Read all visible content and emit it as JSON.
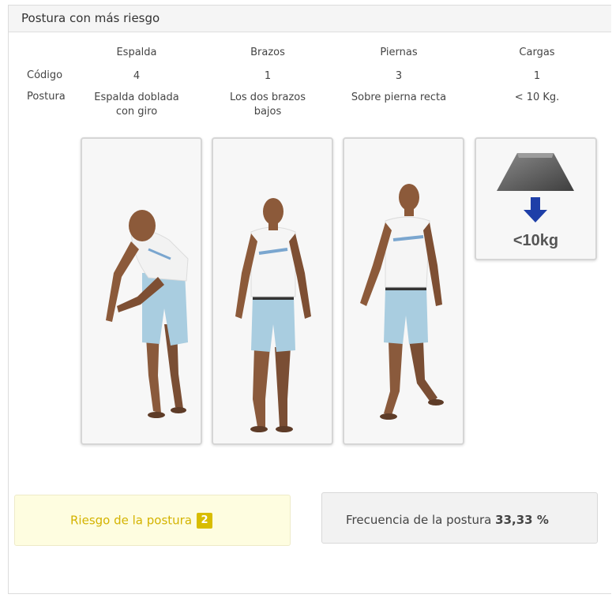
{
  "panel": {
    "title": "Postura con más riesgo"
  },
  "table": {
    "row_labels": {
      "code": "Código",
      "posture": "Postura"
    },
    "columns": [
      {
        "header": "Espalda",
        "code": "4",
        "posture": "Espalda doblada con giro"
      },
      {
        "header": "Brazos",
        "code": "1",
        "posture": "Los dos brazos bajos"
      },
      {
        "header": "Piernas",
        "code": "3",
        "posture": "Sobre pierna recta"
      },
      {
        "header": "Cargas",
        "code": "1",
        "posture": "< 10 Kg."
      }
    ]
  },
  "cards": {
    "back_figure": "bent-twisted-figure",
    "arms_figure": "arms-down-figure",
    "legs_figure": "one-leg-straight-figure",
    "load_icon": "weight-down-arrow-icon",
    "load_label": "<10kg"
  },
  "risk": {
    "label": "Riesgo de la postura",
    "level": "2",
    "color": "#d8bd00"
  },
  "frequency": {
    "label": "Frecuencia de la postura",
    "value": "33,33 %"
  }
}
